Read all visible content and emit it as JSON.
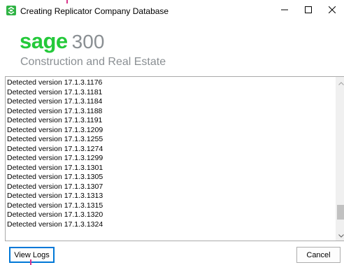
{
  "window": {
    "title": "Creating Replicator Company Database",
    "controls": {
      "minimize_icon": "minimize-icon",
      "maximize_icon": "maximize-icon",
      "close_icon": "close-icon"
    }
  },
  "logo": {
    "brand": "sage",
    "product": "300",
    "subtitle": "Construction and Real Estate",
    "brand_color": "#24c93a",
    "text_color": "#8a8f93"
  },
  "log": {
    "lines": [
      "Detected version 17.1.3.1176",
      "Detected version 17.1.3.1181",
      "Detected version 17.1.3.1184",
      "Detected version 17.1.3.1188",
      "Detected version 17.1.3.1191",
      "Detected version 17.1.3.1209",
      "Detected version 17.1.3.1255",
      "Detected version 17.1.3.1274",
      "Detected version 17.1.3.1299",
      "Detected version 17.1.3.1301",
      "Detected version 17.1.3.1305",
      "Detected version 17.1.3.1307",
      "Detected version 17.1.3.1313",
      "Detected version 17.1.3.1315",
      "Detected version 17.1.3.1320",
      "Detected version 17.1.3.1324"
    ],
    "scroll_position": 0.92
  },
  "buttons": {
    "view_logs": "View Logs",
    "cancel": "Cancel"
  }
}
